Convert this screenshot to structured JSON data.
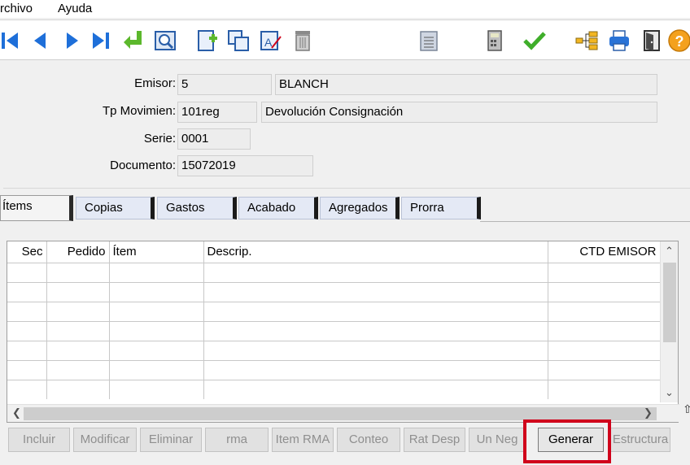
{
  "menu": {
    "file": "rchivo",
    "help": "Ayuda"
  },
  "toolbar": {
    "icons": [
      "first-record-icon",
      "prev-record-icon",
      "next-record-icon",
      "last-record-icon",
      "return-icon",
      "preview-icon",
      "new-document-icon",
      "copy-icon",
      "edit-text-icon",
      "trash-icon",
      "clipboard-icon",
      "calculator-icon",
      "confirm-check-icon",
      "tree-structure-icon",
      "printer-icon",
      "exit-door-icon",
      "help-icon"
    ]
  },
  "form": {
    "emisor_label": "Emisor:",
    "emisor_code": "5",
    "emisor_name": "BLANCH",
    "tpmov_label": "Tp Movimien:",
    "tpmov_code": "101reg",
    "tpmov_name": "Devolución Consignación",
    "serie_label": "Serie:",
    "serie_value": "0001",
    "doc_label": "Documento:",
    "doc_value": "15072019"
  },
  "tabs": [
    "Ítems",
    "Copias",
    "Gastos",
    "Acabado",
    "Agregados",
    "Prorra"
  ],
  "grid": {
    "headers": [
      "Sec",
      "Pedido",
      "Ítem",
      "Descrip.",
      "CTD EMISOR"
    ],
    "rows": 7
  },
  "buttons": [
    "Incluir",
    "Modificar",
    "Eliminar",
    "rma",
    "Item RMA",
    "Conteo",
    "Rat Desp",
    "Un Neg",
    "Generar",
    "Estructura"
  ],
  "colors": {
    "highlight": "#d0021b",
    "tab_bg": "#e4e9f5",
    "accent_blue": "#1e6fd9"
  }
}
